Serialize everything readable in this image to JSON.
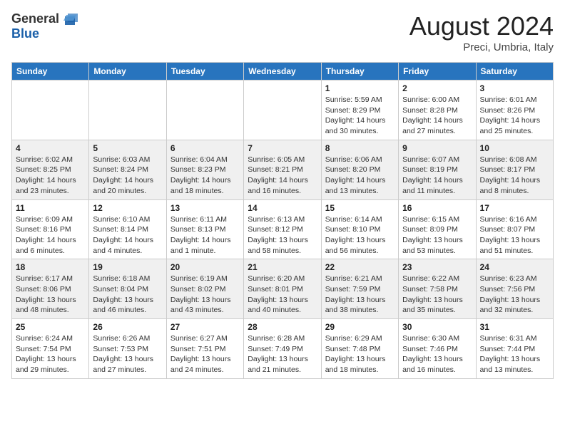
{
  "header": {
    "logo_general": "General",
    "logo_blue": "Blue",
    "month_title": "August 2024",
    "location": "Preci, Umbria, Italy"
  },
  "weekdays": [
    "Sunday",
    "Monday",
    "Tuesday",
    "Wednesday",
    "Thursday",
    "Friday",
    "Saturday"
  ],
  "weeks": [
    [
      {
        "day": "",
        "sunrise": "",
        "sunset": "",
        "daylight": ""
      },
      {
        "day": "",
        "sunrise": "",
        "sunset": "",
        "daylight": ""
      },
      {
        "day": "",
        "sunrise": "",
        "sunset": "",
        "daylight": ""
      },
      {
        "day": "",
        "sunrise": "",
        "sunset": "",
        "daylight": ""
      },
      {
        "day": "1",
        "sunrise": "Sunrise: 5:59 AM",
        "sunset": "Sunset: 8:29 PM",
        "daylight": "Daylight: 14 hours and 30 minutes."
      },
      {
        "day": "2",
        "sunrise": "Sunrise: 6:00 AM",
        "sunset": "Sunset: 8:28 PM",
        "daylight": "Daylight: 14 hours and 27 minutes."
      },
      {
        "day": "3",
        "sunrise": "Sunrise: 6:01 AM",
        "sunset": "Sunset: 8:26 PM",
        "daylight": "Daylight: 14 hours and 25 minutes."
      }
    ],
    [
      {
        "day": "4",
        "sunrise": "Sunrise: 6:02 AM",
        "sunset": "Sunset: 8:25 PM",
        "daylight": "Daylight: 14 hours and 23 minutes."
      },
      {
        "day": "5",
        "sunrise": "Sunrise: 6:03 AM",
        "sunset": "Sunset: 8:24 PM",
        "daylight": "Daylight: 14 hours and 20 minutes."
      },
      {
        "day": "6",
        "sunrise": "Sunrise: 6:04 AM",
        "sunset": "Sunset: 8:23 PM",
        "daylight": "Daylight: 14 hours and 18 minutes."
      },
      {
        "day": "7",
        "sunrise": "Sunrise: 6:05 AM",
        "sunset": "Sunset: 8:21 PM",
        "daylight": "Daylight: 14 hours and 16 minutes."
      },
      {
        "day": "8",
        "sunrise": "Sunrise: 6:06 AM",
        "sunset": "Sunset: 8:20 PM",
        "daylight": "Daylight: 14 hours and 13 minutes."
      },
      {
        "day": "9",
        "sunrise": "Sunrise: 6:07 AM",
        "sunset": "Sunset: 8:19 PM",
        "daylight": "Daylight: 14 hours and 11 minutes."
      },
      {
        "day": "10",
        "sunrise": "Sunrise: 6:08 AM",
        "sunset": "Sunset: 8:17 PM",
        "daylight": "Daylight: 14 hours and 8 minutes."
      }
    ],
    [
      {
        "day": "11",
        "sunrise": "Sunrise: 6:09 AM",
        "sunset": "Sunset: 8:16 PM",
        "daylight": "Daylight: 14 hours and 6 minutes."
      },
      {
        "day": "12",
        "sunrise": "Sunrise: 6:10 AM",
        "sunset": "Sunset: 8:14 PM",
        "daylight": "Daylight: 14 hours and 4 minutes."
      },
      {
        "day": "13",
        "sunrise": "Sunrise: 6:11 AM",
        "sunset": "Sunset: 8:13 PM",
        "daylight": "Daylight: 14 hours and 1 minute."
      },
      {
        "day": "14",
        "sunrise": "Sunrise: 6:13 AM",
        "sunset": "Sunset: 8:12 PM",
        "daylight": "Daylight: 13 hours and 58 minutes."
      },
      {
        "day": "15",
        "sunrise": "Sunrise: 6:14 AM",
        "sunset": "Sunset: 8:10 PM",
        "daylight": "Daylight: 13 hours and 56 minutes."
      },
      {
        "day": "16",
        "sunrise": "Sunrise: 6:15 AM",
        "sunset": "Sunset: 8:09 PM",
        "daylight": "Daylight: 13 hours and 53 minutes."
      },
      {
        "day": "17",
        "sunrise": "Sunrise: 6:16 AM",
        "sunset": "Sunset: 8:07 PM",
        "daylight": "Daylight: 13 hours and 51 minutes."
      }
    ],
    [
      {
        "day": "18",
        "sunrise": "Sunrise: 6:17 AM",
        "sunset": "Sunset: 8:06 PM",
        "daylight": "Daylight: 13 hours and 48 minutes."
      },
      {
        "day": "19",
        "sunrise": "Sunrise: 6:18 AM",
        "sunset": "Sunset: 8:04 PM",
        "daylight": "Daylight: 13 hours and 46 minutes."
      },
      {
        "day": "20",
        "sunrise": "Sunrise: 6:19 AM",
        "sunset": "Sunset: 8:02 PM",
        "daylight": "Daylight: 13 hours and 43 minutes."
      },
      {
        "day": "21",
        "sunrise": "Sunrise: 6:20 AM",
        "sunset": "Sunset: 8:01 PM",
        "daylight": "Daylight: 13 hours and 40 minutes."
      },
      {
        "day": "22",
        "sunrise": "Sunrise: 6:21 AM",
        "sunset": "Sunset: 7:59 PM",
        "daylight": "Daylight: 13 hours and 38 minutes."
      },
      {
        "day": "23",
        "sunrise": "Sunrise: 6:22 AM",
        "sunset": "Sunset: 7:58 PM",
        "daylight": "Daylight: 13 hours and 35 minutes."
      },
      {
        "day": "24",
        "sunrise": "Sunrise: 6:23 AM",
        "sunset": "Sunset: 7:56 PM",
        "daylight": "Daylight: 13 hours and 32 minutes."
      }
    ],
    [
      {
        "day": "25",
        "sunrise": "Sunrise: 6:24 AM",
        "sunset": "Sunset: 7:54 PM",
        "daylight": "Daylight: 13 hours and 29 minutes."
      },
      {
        "day": "26",
        "sunrise": "Sunrise: 6:26 AM",
        "sunset": "Sunset: 7:53 PM",
        "daylight": "Daylight: 13 hours and 27 minutes."
      },
      {
        "day": "27",
        "sunrise": "Sunrise: 6:27 AM",
        "sunset": "Sunset: 7:51 PM",
        "daylight": "Daylight: 13 hours and 24 minutes."
      },
      {
        "day": "28",
        "sunrise": "Sunrise: 6:28 AM",
        "sunset": "Sunset: 7:49 PM",
        "daylight": "Daylight: 13 hours and 21 minutes."
      },
      {
        "day": "29",
        "sunrise": "Sunrise: 6:29 AM",
        "sunset": "Sunset: 7:48 PM",
        "daylight": "Daylight: 13 hours and 18 minutes."
      },
      {
        "day": "30",
        "sunrise": "Sunrise: 6:30 AM",
        "sunset": "Sunset: 7:46 PM",
        "daylight": "Daylight: 13 hours and 16 minutes."
      },
      {
        "day": "31",
        "sunrise": "Sunrise: 6:31 AM",
        "sunset": "Sunset: 7:44 PM",
        "daylight": "Daylight: 13 hours and 13 minutes."
      }
    ]
  ]
}
